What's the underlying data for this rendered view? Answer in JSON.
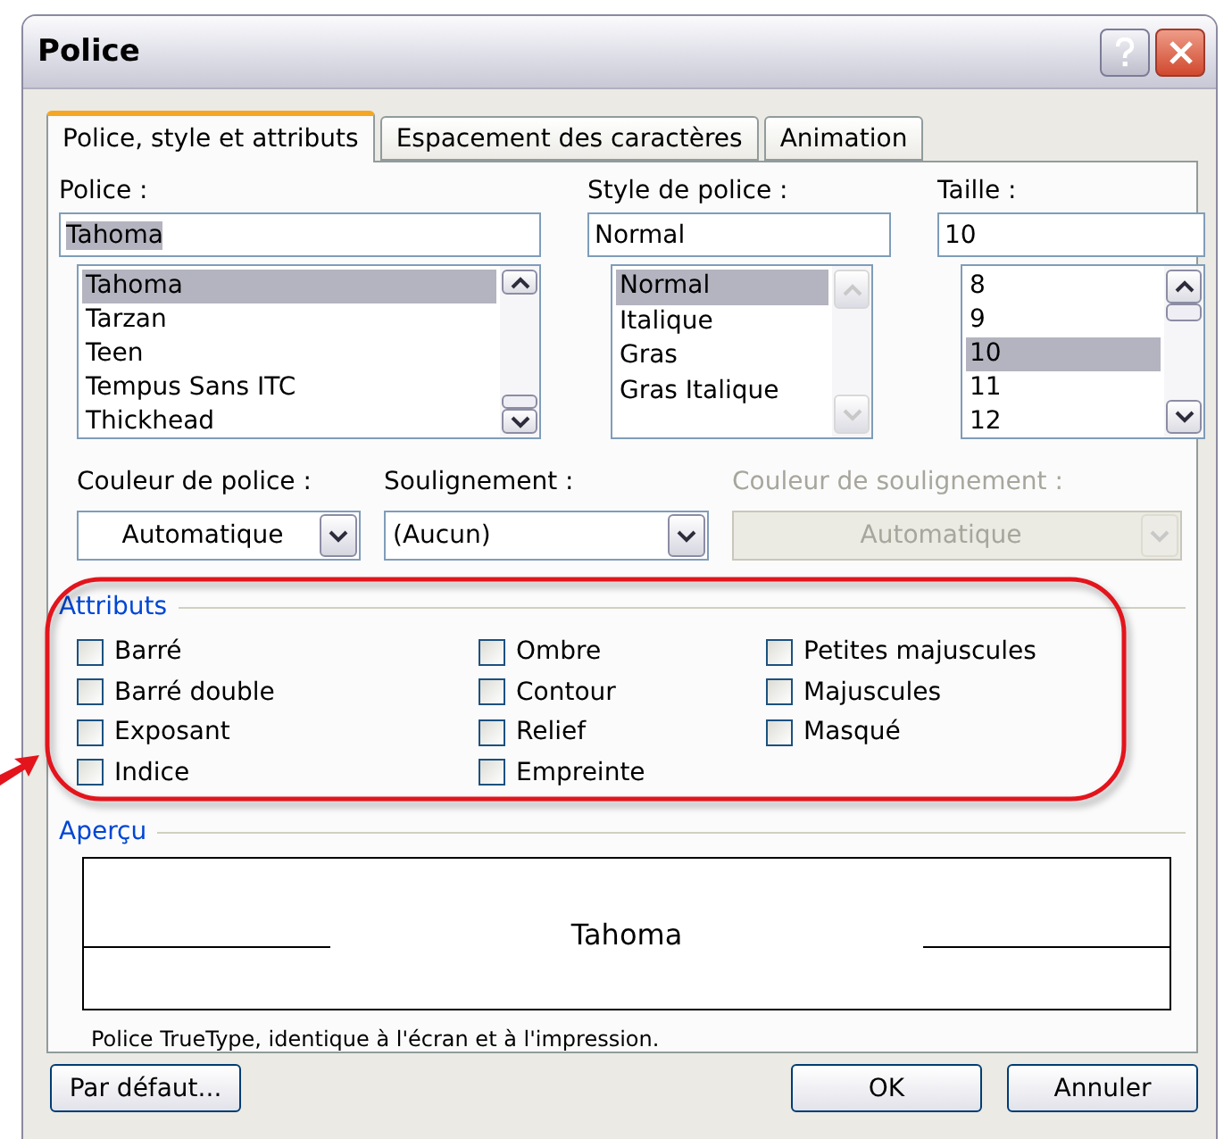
{
  "window": {
    "title": "Police"
  },
  "tabs": [
    {
      "label": "Police, style et attributs",
      "selected": true
    },
    {
      "label": "Espacement des caractères",
      "selected": false
    },
    {
      "label": "Animation",
      "selected": false
    }
  ],
  "pickers": [
    {
      "label": "Police :",
      "value": "Tahoma",
      "value_selected": true,
      "scrollbar_disabled": false,
      "items": [
        {
          "label": "Tahoma",
          "selected": true
        },
        {
          "label": "Tarzan",
          "selected": false
        },
        {
          "label": "Teen",
          "selected": false
        },
        {
          "label": "Tempus Sans ITC",
          "selected": false
        },
        {
          "label": "Thickhead",
          "selected": false
        }
      ]
    },
    {
      "label": "Style de police :",
      "value": "Normal",
      "value_selected": false,
      "scrollbar_disabled": true,
      "items": [
        {
          "label": "Normal",
          "selected": true
        },
        {
          "label": "Italique",
          "selected": false
        },
        {
          "label": "Gras",
          "selected": false
        },
        {
          "label": "Gras Italique",
          "selected": false
        }
      ]
    },
    {
      "label": "Taille :",
      "value": "10",
      "value_selected": false,
      "scrollbar_disabled": false,
      "items": [
        {
          "label": "8",
          "selected": false
        },
        {
          "label": "9",
          "selected": false
        },
        {
          "label": "10",
          "selected": true
        },
        {
          "label": "11",
          "selected": false
        },
        {
          "label": "12",
          "selected": false
        }
      ]
    }
  ],
  "combos": [
    {
      "label": "Couleur de police :",
      "value": "Automatique",
      "centered": true,
      "disabled": false
    },
    {
      "label": "Soulignement :",
      "value": "(Aucun)",
      "centered": false,
      "disabled": false
    },
    {
      "label": "Couleur de soulignement :",
      "value": "Automatique",
      "centered": true,
      "disabled": true
    }
  ],
  "attributes": {
    "title": "Attributs",
    "columns": [
      [
        {
          "label": "Barré",
          "checked": false
        },
        {
          "label": "Barré double",
          "checked": false
        },
        {
          "label": "Exposant",
          "checked": false
        },
        {
          "label": "Indice",
          "checked": false
        }
      ],
      [
        {
          "label": "Ombre",
          "checked": false
        },
        {
          "label": "Contour",
          "checked": false
        },
        {
          "label": "Relief",
          "checked": false
        },
        {
          "label": "Empreinte",
          "checked": false
        }
      ],
      [
        {
          "label": "Petites majuscules",
          "checked": false
        },
        {
          "label": "Majuscules",
          "checked": false
        },
        {
          "label": "Masqué",
          "checked": false
        }
      ]
    ]
  },
  "preview": {
    "title": "Aperçu",
    "sample": "Tahoma",
    "note": "Police TrueType, identique à l'écran et à l'impression."
  },
  "buttons": [
    {
      "label": "Par défaut...",
      "kind": "left"
    },
    {
      "label": "OK",
      "kind": "right"
    },
    {
      "label": "Annuler",
      "kind": "right"
    }
  ]
}
